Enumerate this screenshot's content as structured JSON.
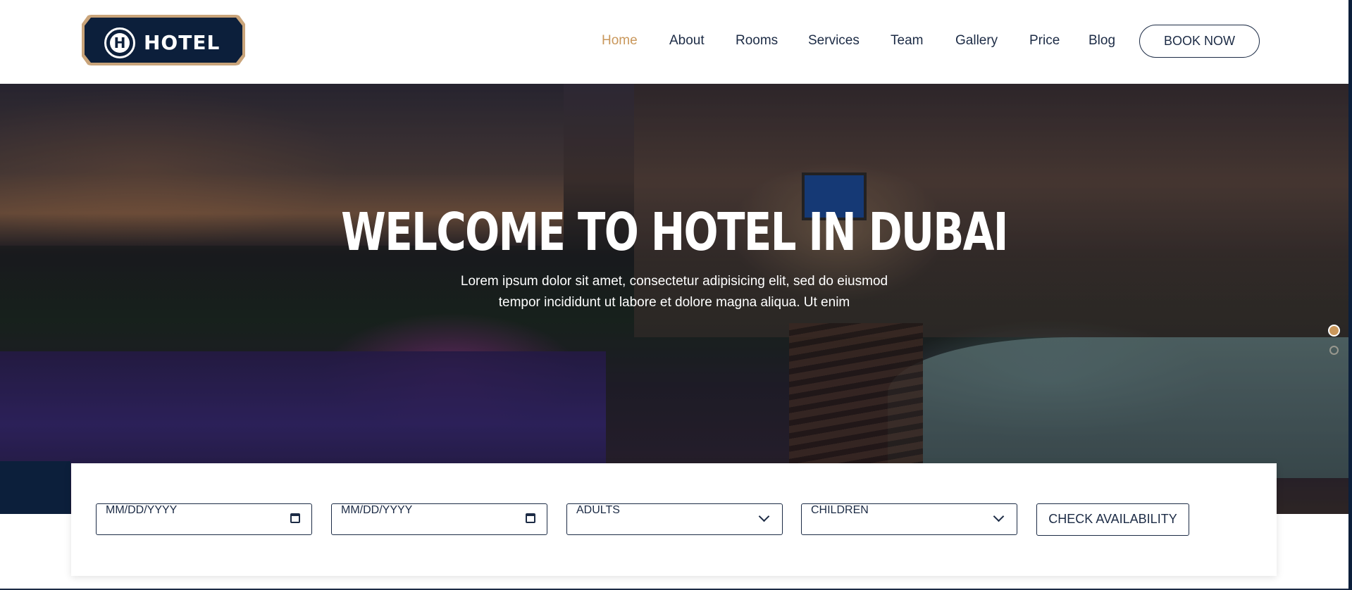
{
  "brand": {
    "logo_letter": "H",
    "logo_text": "HOTEL"
  },
  "nav": {
    "items": [
      {
        "label": "Home",
        "active": true
      },
      {
        "label": "About",
        "active": false
      },
      {
        "label": "Rooms",
        "active": false
      },
      {
        "label": "Services",
        "active": false
      },
      {
        "label": "Team",
        "active": false
      },
      {
        "label": "Gallery",
        "active": false
      },
      {
        "label": "Price",
        "active": false
      },
      {
        "label": "Blog",
        "active": false
      }
    ],
    "cta": "BOOK NOW"
  },
  "hero": {
    "title": "WELCOME TO HOTEL IN DUBAI",
    "subtitle_line1": "Lorem ipsum dolor sit amet, consectetur adipisicing elit, sed do eiusmod",
    "subtitle_line2": "tempor incididunt ut labore et dolore magna aliqua. Ut enim",
    "slides": {
      "count": 2,
      "active": 1
    }
  },
  "booking": {
    "checkin_placeholder": "MM/DD/YYYY",
    "checkout_placeholder": "MM/DD/YYYY",
    "adults_selected": "ADULTS",
    "children_selected": "CHILDREN",
    "submit_label": "CHECK AVAILABILITY"
  },
  "colors": {
    "accent": "#c9975b",
    "navy": "#0c1f3b",
    "text": "#1c2b45"
  }
}
